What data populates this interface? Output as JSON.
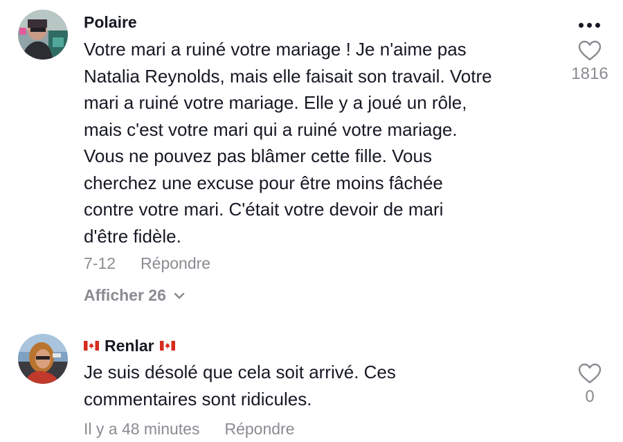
{
  "comments": [
    {
      "username": "Polaire",
      "text": "Votre mari a ruiné votre mariage ! Je n'aime pas\nNatalia Reynolds, mais elle faisait son travail. Votre\nmari a ruiné votre mariage. Elle y a joué un rôle,\nmais c'est votre mari qui a ruiné votre mariage.\nVous ne pouvez pas blâmer cette fille. Vous\ncherchez une excuse pour être moins fâchée\ncontre votre mari. C'était votre devoir de mari\nd'être fidèle.",
      "date": "7-12",
      "reply_label": "Répondre",
      "view_replies_label": "Afficher 26",
      "likes": "1816",
      "avatar_icon": "user-avatar",
      "heart_icon": "heart-outline-icon",
      "more_icon": "more-dots-icon"
    },
    {
      "username": "Renlar",
      "flag_icon": "canada-flag-icon",
      "text": "Je suis désolé que cela soit arrivé. Ces\ncommentaires sont ridicules.",
      "date": "Il y a 48 minutes",
      "reply_label": "Répondre",
      "likes": "0",
      "avatar_icon": "user-avatar",
      "heart_icon": "heart-outline-icon"
    }
  ],
  "colors": {
    "text_primary": "#161823",
    "text_secondary": "#8a8b91",
    "flag_red": "#d52b1e",
    "background": "#ffffff"
  }
}
